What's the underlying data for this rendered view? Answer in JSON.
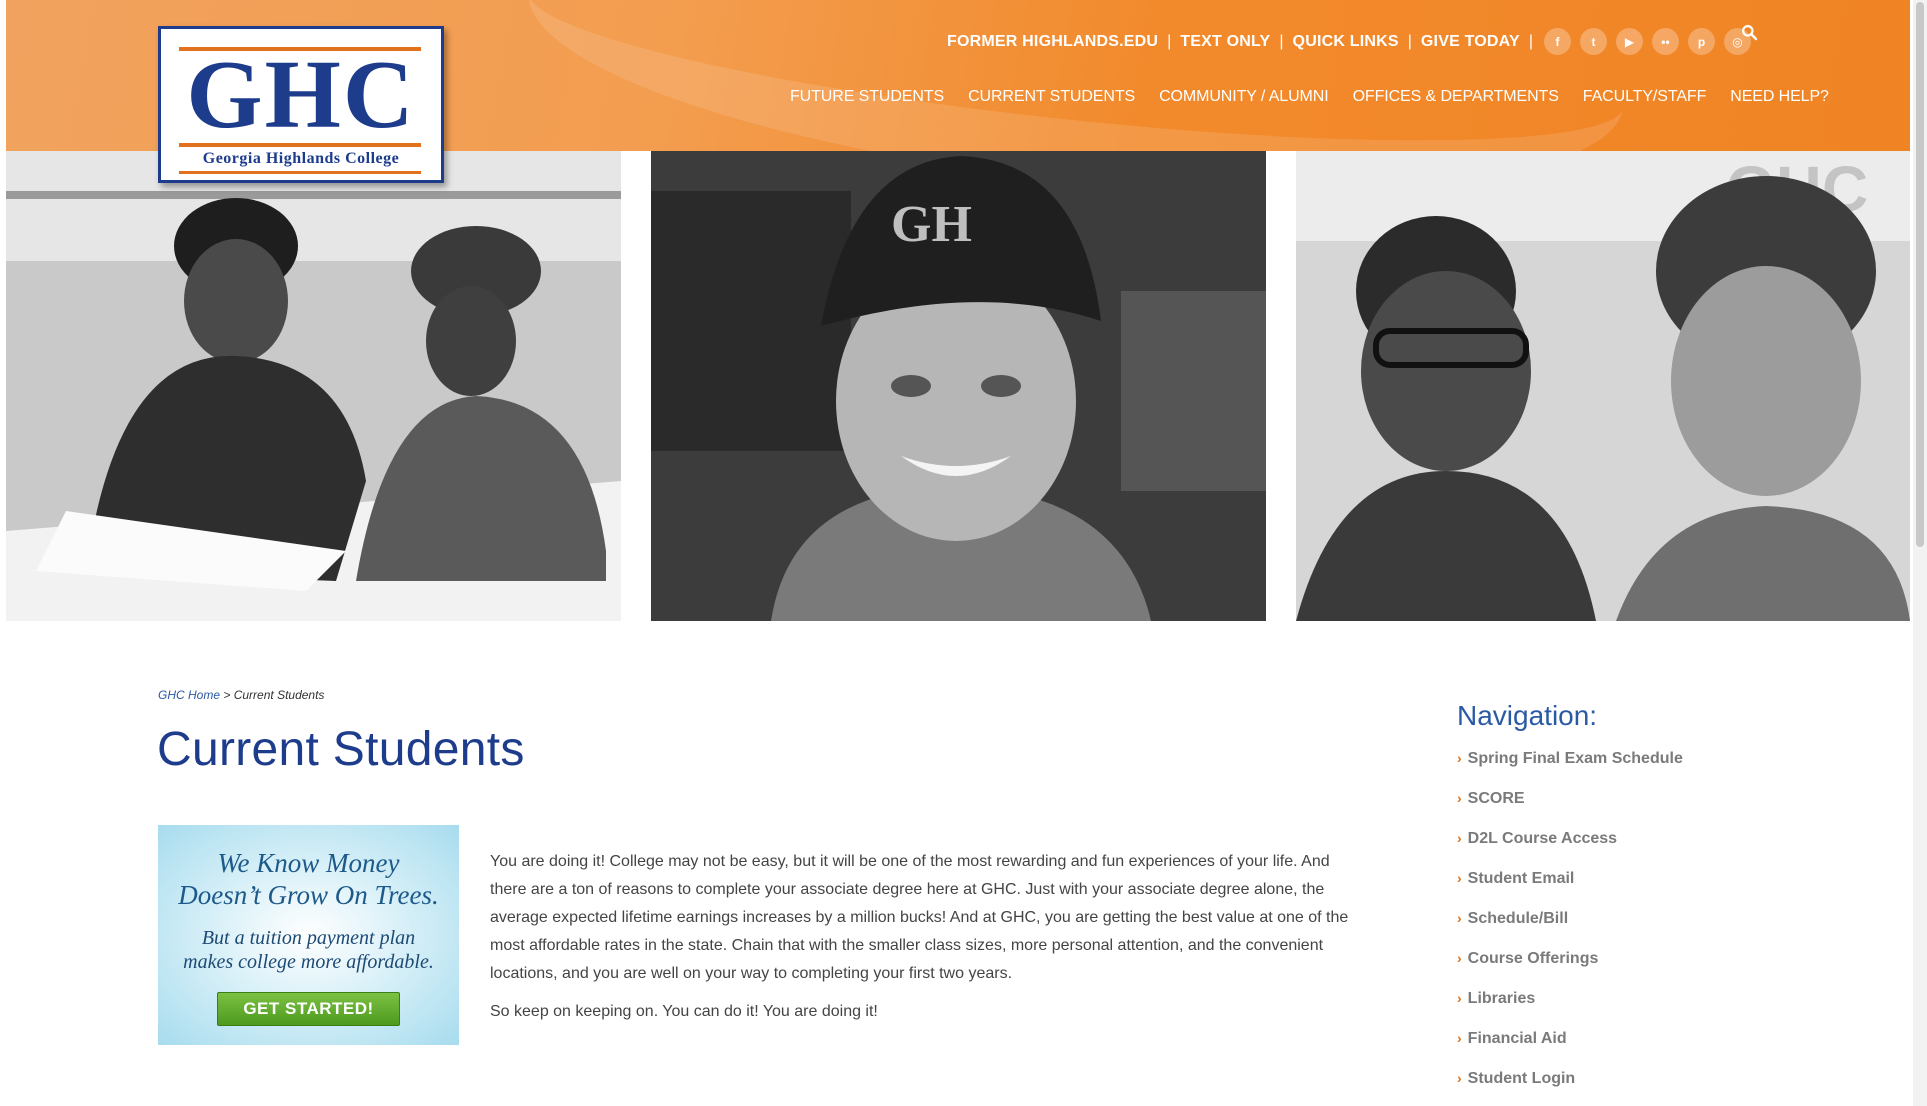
{
  "logo": {
    "letters": "GHC",
    "name": "Georgia Highlands College"
  },
  "utility_links": [
    "FORMER HIGHLANDS.EDU",
    "TEXT ONLY",
    "QUICK LINKS",
    "GIVE TODAY"
  ],
  "utility_separator": "|",
  "social": [
    {
      "icon": "facebook-icon",
      "glyph": "f"
    },
    {
      "icon": "twitter-icon",
      "glyph": "t"
    },
    {
      "icon": "youtube-icon",
      "glyph": "▶"
    },
    {
      "icon": "flickr-icon",
      "glyph": "••"
    },
    {
      "icon": "pinterest-icon",
      "glyph": "p"
    },
    {
      "icon": "instagram-icon",
      "glyph": "◎"
    }
  ],
  "main_nav": [
    "FUTURE STUDENTS",
    "CURRENT STUDENTS",
    "COMMUNITY / ALUMNI",
    "OFFICES & DEPARTMENTS",
    "FACULTY/STAFF",
    "NEED HELP?"
  ],
  "photos": [
    {
      "name": "photo-students-studying"
    },
    {
      "name": "photo-student-smiling"
    },
    {
      "name": "photo-mentor-student"
    }
  ],
  "breadcrumb": {
    "home": "GHC Home",
    "separator": ">",
    "current": "Current Students"
  },
  "page_title": "Current Students",
  "promo": {
    "headline_1": "We Know Money",
    "headline_2": "Doesn’t Grow On Trees.",
    "sub_1": "But a tuition payment plan",
    "sub_2": "makes college more affordable.",
    "cta": "GET STARTED!"
  },
  "body": {
    "paragraph_1": "You are doing it! College may not be easy, but it will be one of the most rewarding and fun experiences of your life. And there are a ton of reasons to complete your associate degree here at GHC. Just with your associate degree alone, the average expected lifetime earnings increases by a million bucks! And at GHC, you are getting the best value at one of the most affordable rates in the state. Chain that with the smaller class sizes, more personal attention, and the convenient locations, and you are well on your way to completing your first two years.",
    "paragraph_2": "So keep on keeping on. You can do it! You are doing it!"
  },
  "sidebar": {
    "title": "Navigation:",
    "chevron": "›",
    "items": [
      "Spring Final Exam Schedule",
      "SCORE",
      "D2L Course Access",
      "Student Email",
      "Schedule/Bill",
      "Course Offerings",
      "Libraries",
      "Financial Aid",
      "Student Login"
    ]
  },
  "colors": {
    "brand_blue": "#1d3c8c",
    "brand_orange": "#f08424",
    "link_blue": "#2b5aa5",
    "cta_green": "#5fae2b"
  }
}
